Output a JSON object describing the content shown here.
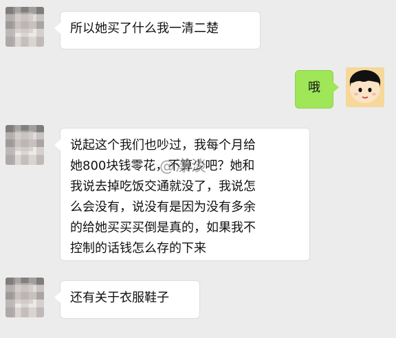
{
  "messages": [
    {
      "side": "left",
      "text": "所以她买了什么我一清二楚"
    },
    {
      "side": "right",
      "text": "哦"
    },
    {
      "side": "left",
      "lines": [
        "说起这个我们也吵过，我每个月给",
        "她800块钱零花，不算少吧？她和",
        "我说去掉吃饭交通就没了，我说怎",
        "么会没有，说没有是因为没有多余",
        "的给她买买买倒是真的，如果我不",
        "控制的话钱怎么存的下来"
      ]
    },
    {
      "side": "left",
      "text": "还有关于衣服鞋子"
    }
  ],
  "watermark": "@漾淡",
  "colors": {
    "background": "#ececec",
    "sent_bubble": "#9fe658",
    "received_bubble": "#ffffff"
  },
  "icons": {
    "right_avatar": "cartoon-girl-avatar",
    "left_avatar": "pixelated-avatar"
  }
}
